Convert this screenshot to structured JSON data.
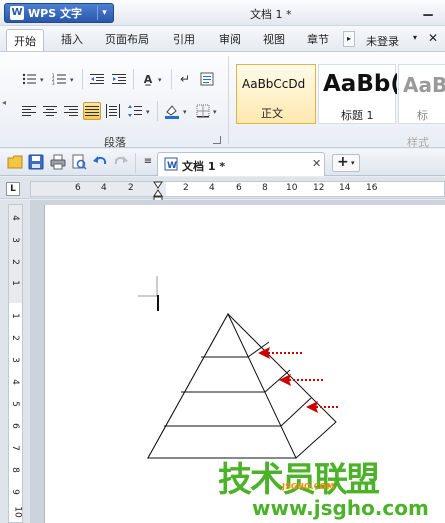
{
  "app": {
    "name": "WPS 文字",
    "document_title": "文档 1 *"
  },
  "menu": {
    "tabs": [
      "开始",
      "插入",
      "页面布局",
      "引用",
      "审阅",
      "视图",
      "章节"
    ],
    "login": "未登录"
  },
  "ribbon": {
    "paragraph_group_label": "段落",
    "styles_group_label": "样式",
    "styles": [
      {
        "sample": "AaBbCcDd",
        "name": "正文"
      },
      {
        "sample": "AaBb(",
        "name": "标题 1"
      },
      {
        "sample": "AaB",
        "name": "标"
      }
    ]
  },
  "doc_tab": {
    "label": "文档 1 *"
  },
  "ruler": {
    "horizontal": [
      "6",
      "4",
      "2",
      "2",
      "4",
      "6",
      "8",
      "10",
      "12",
      "14",
      "16"
    ],
    "vertical": [
      "4",
      "3",
      "2",
      "1",
      "1",
      "2",
      "3",
      "4",
      "5",
      "6",
      "7",
      "8",
      "9",
      "10"
    ]
  },
  "watermark": {
    "title": "技术员联盟",
    "url": "www.jsgho.com",
    "small": "JSGHO.COM"
  },
  "icons": [
    "file-icon",
    "save-icon",
    "print-icon",
    "preview-icon",
    "undo-icon",
    "redo-icon",
    "qa-dropdown-icon"
  ]
}
